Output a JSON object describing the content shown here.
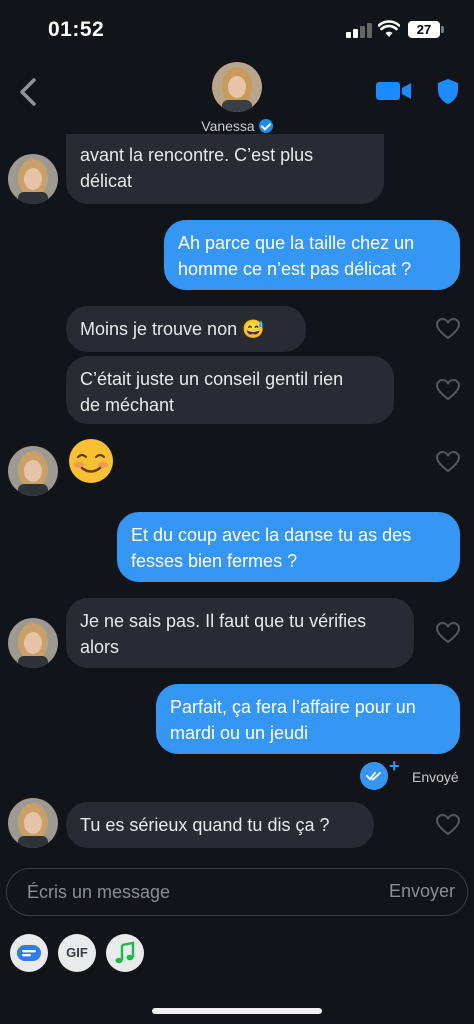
{
  "status_bar": {
    "time": "01:52",
    "battery": "27",
    "icons": [
      "signal-icon",
      "wifi-icon",
      "battery-icon"
    ]
  },
  "header": {
    "name": "Vanessa",
    "verified": true,
    "icons": [
      "back-icon",
      "video-call-icon",
      "shield-icon"
    ]
  },
  "messages": [
    {
      "side": "in",
      "text_lines": [
        "avant la rencontre. C’est plus",
        "délicat"
      ],
      "avatar": true
    },
    {
      "side": "out",
      "text_lines": [
        "Ah parce que la taille chez un",
        "homme ce n’est pas délicat ?"
      ]
    },
    {
      "side": "in",
      "text_lines": [
        "Moins je trouve non 😅"
      ],
      "liked": false
    },
    {
      "side": "in",
      "text_lines": [
        "C’était juste un conseil gentil rien",
        "de méchant"
      ],
      "liked": false
    },
    {
      "side": "in",
      "emoji": "smiling-face-emoji",
      "avatar": true,
      "liked": false
    },
    {
      "side": "out",
      "text_lines": [
        "Et du coup avec la danse tu as des",
        "fesses bien fermes ?"
      ]
    },
    {
      "side": "in",
      "text_lines": [
        "Je ne sais pas. Il faut que tu vérifies",
        "alors"
      ],
      "avatar": true,
      "liked": false
    },
    {
      "side": "out",
      "text_lines": [
        "Parfait, ça fera l’affaire pour un",
        "mardi ou un jeudi"
      ]
    },
    {
      "side": "in",
      "text_lines": [
        "Tu es sérieux quand tu dis ça ?"
      ],
      "avatar": true,
      "liked": false
    }
  ],
  "sent_status": "Envoyé",
  "composer": {
    "placeholder": "Écris un message",
    "send_label": "Envoyer"
  },
  "toolbar": {
    "gif_label": "GIF",
    "icons": [
      "sticker-icon",
      "gif-icon",
      "music-icon"
    ]
  },
  "colors": {
    "background": "#111418",
    "incoming_bubble": "#282b31",
    "outgoing_bubble": "#3596f4",
    "accent": "#1a8cff"
  }
}
